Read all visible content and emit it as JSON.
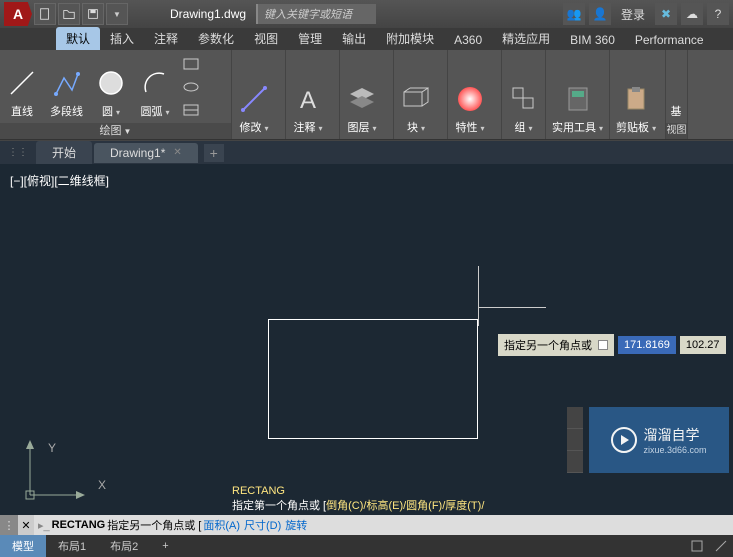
{
  "title": {
    "filename": "Drawing1.dwg",
    "search_placeholder": "键入关键字或短语",
    "login": "登录"
  },
  "ribbon_tabs": [
    "默认",
    "插入",
    "注释",
    "参数化",
    "视图",
    "管理",
    "输出",
    "附加模块",
    "A360",
    "精选应用",
    "BIM 360",
    "Performance"
  ],
  "ribbon_active": 0,
  "panels": {
    "draw": {
      "title": "绘图",
      "line": "直线",
      "polyline": "多段线",
      "circle": "圆",
      "arc": "圆弧"
    },
    "modify": "修改",
    "annot": "注释",
    "layer": "图层",
    "block": "块",
    "prop": "特性",
    "group": "组",
    "util": "实用工具",
    "clip": "剪贴板",
    "base": "基",
    "view": "视图"
  },
  "file_tabs": {
    "start": "开始",
    "drawing": "Drawing1*"
  },
  "viewport_label": "[−][俯视][二维线框]",
  "ucs": {
    "x": "X",
    "y": "Y"
  },
  "dyn": {
    "label": "指定另一个角点或",
    "v1": "171.8169",
    "v2": "102.27"
  },
  "cmd_history": {
    "cmd": "RECTANG",
    "prompt_prefix": "指定第一个角点或 [",
    "opts": "倒角(C)/标高(E)/圆角(F)/厚度(T)/",
    "suffix": "]"
  },
  "cmd_line": {
    "prefix": "▸▹",
    "name": "RECTANG",
    "prompt": "指定另一个角点或 [",
    "o1": "面积(A)",
    "o2": "尺寸(D)",
    "o3": "旋转",
    "sep": " "
  },
  "status_tabs": {
    "model": "模型",
    "l1": "布局1",
    "l2": "布局2"
  },
  "watermark": {
    "title": "溜溜自学",
    "url": "zixue.3d66.com"
  }
}
